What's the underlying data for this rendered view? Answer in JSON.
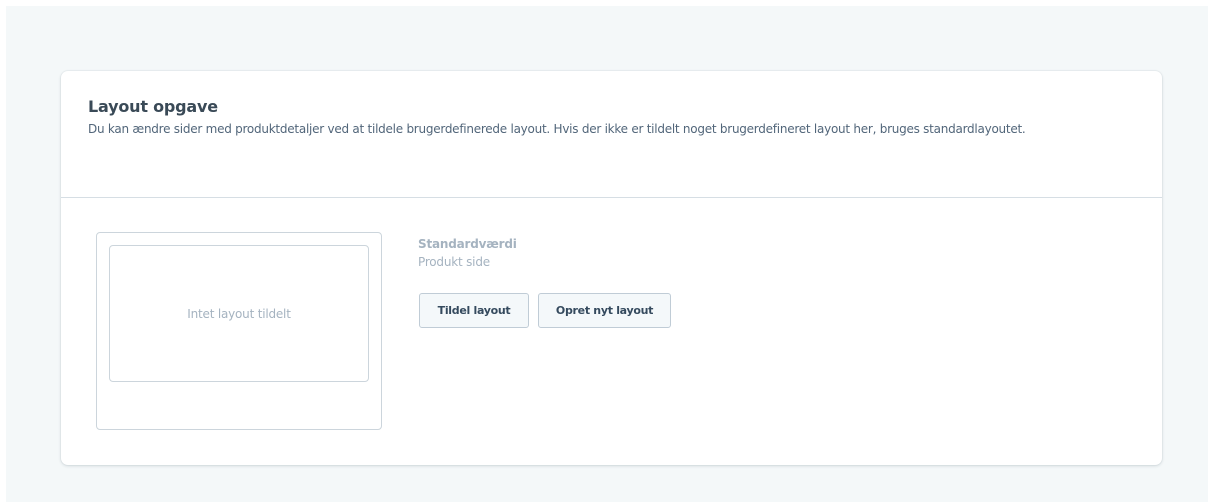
{
  "layout_assignment": {
    "title": "Layout opgave",
    "description": "Du kan ændre sider med produktdetaljer ved at tildele brugerdefinerede layout. Hvis der ikke er tildelt noget brugerdefineret layout her, bruges standardlayoutet.",
    "preview": {
      "empty_text": "Intet layout tildelt"
    },
    "default_label": "Standardværdi",
    "page_type": "Produkt side",
    "buttons": {
      "assign": "Tildel layout",
      "create": "Opret nyt layout"
    }
  }
}
